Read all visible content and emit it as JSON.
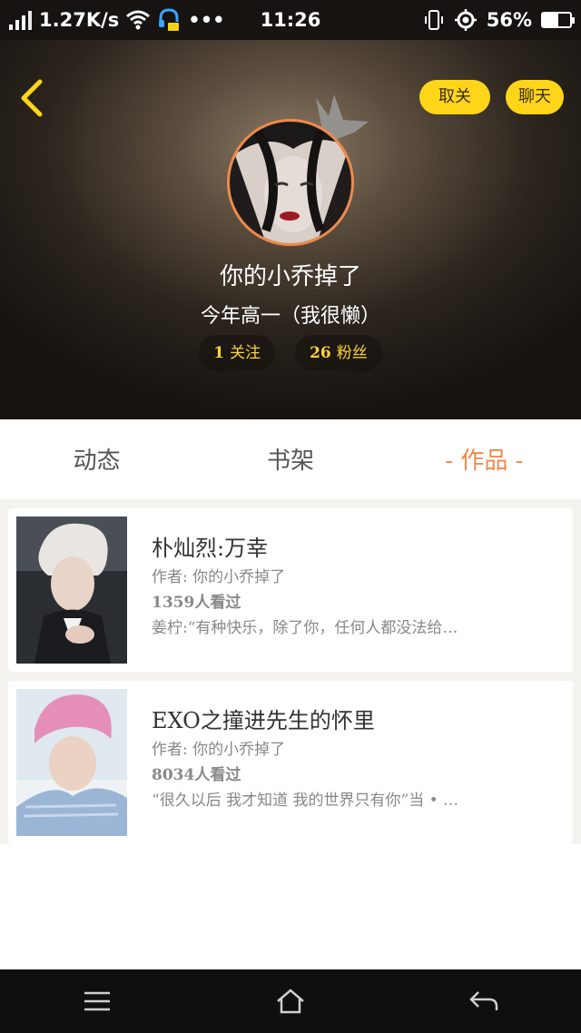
{
  "status_bar": {
    "net_speed": "1.27K/s",
    "time": "11:26",
    "battery_percent": "56%",
    "battery_level": 0.56,
    "icons": [
      "signal-icon",
      "wifi-icon",
      "headset-notification-icon",
      "more-dots-icon",
      "vibrate-icon",
      "location-icon",
      "battery-icon"
    ]
  },
  "header": {
    "unfollow_label": "取关",
    "chat_label": "聊天",
    "username": "你的小乔掉了",
    "bio": "今年高一（我很懒）",
    "following_count": "1",
    "following_label": "关注",
    "fans_count": "26",
    "fans_label": "粉丝",
    "accent_color": "#ffd51a",
    "avatar_border_color": "#f08a4b"
  },
  "tabs": [
    {
      "label": "动态",
      "active": false
    },
    {
      "label": "书架",
      "active": false
    },
    {
      "label": "- 作品 -",
      "active": true
    }
  ],
  "works": [
    {
      "title": "朴灿烈:万幸",
      "author": "作者: 你的小乔掉了",
      "views": "1359人看过",
      "desc": "姜柠:“有种快乐，除了你，任何人都没法给…"
    },
    {
      "title": "EXO之撞进先生的怀里",
      "author": "作者: 你的小乔掉了",
      "views": "8034人看过",
      "desc": "“很久以后 我才知道 我的世界只有你”当 • …"
    }
  ],
  "nav": {
    "icons": [
      "menu-icon",
      "home-icon",
      "back-arrow-icon"
    ]
  }
}
